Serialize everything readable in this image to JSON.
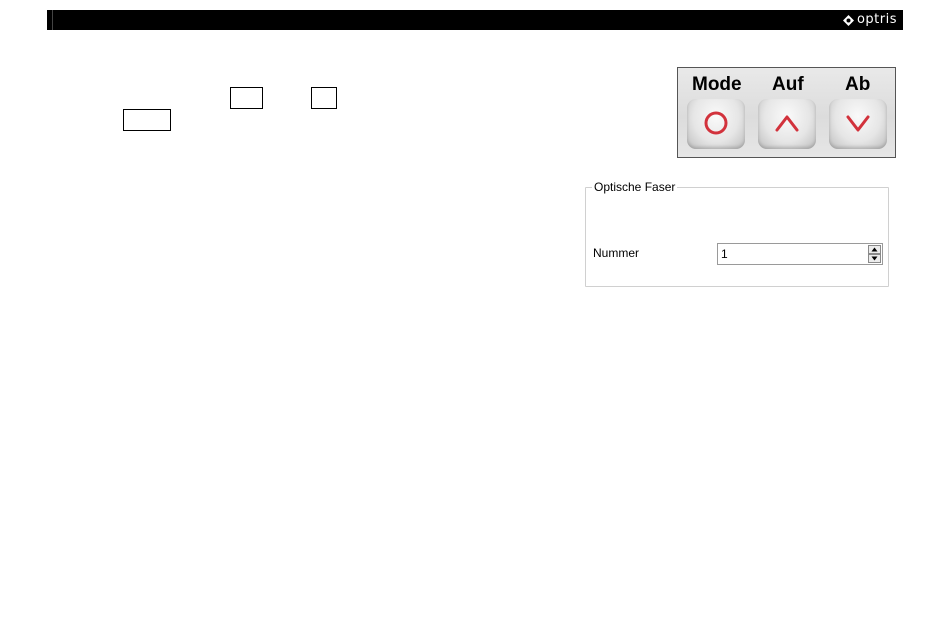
{
  "header": {
    "logo_text": "optris",
    "logo_icon": "optris-logo-icon"
  },
  "keypad": {
    "keys": [
      {
        "label": "Mode",
        "icon": "circle-icon",
        "color": "#d2323c"
      },
      {
        "label": "Auf",
        "icon": "chevron-up-icon",
        "color": "#d2323c"
      },
      {
        "label": "Ab",
        "icon": "chevron-down-icon",
        "color": "#d2323c"
      }
    ]
  },
  "fiber_group": {
    "title": "Optische Faser",
    "number_label": "Nummer",
    "number_value": "1",
    "spin_up_icon": "spin-up-arrow-icon",
    "spin_down_icon": "spin-down-arrow-icon"
  }
}
